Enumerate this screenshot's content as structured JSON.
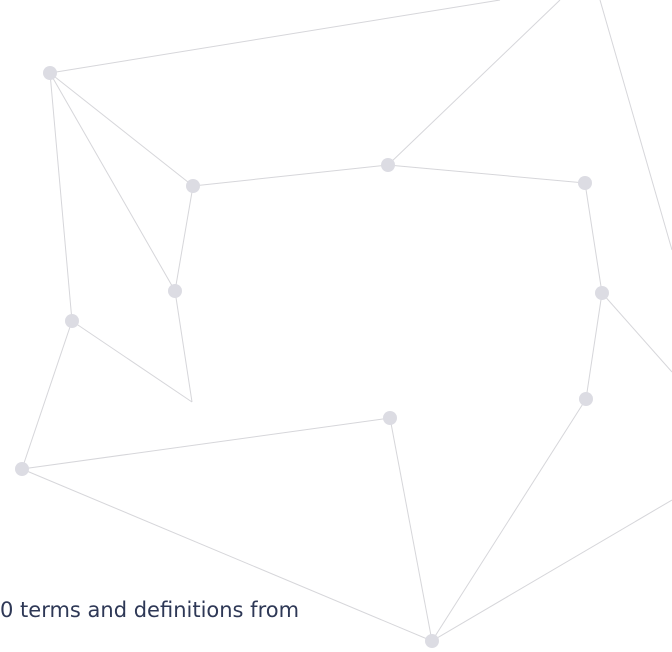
{
  "caption": "0 terms and definitions from",
  "colors": {
    "background": "#ffffff",
    "node": "#dcdce3",
    "edge": "#d6d6da",
    "text": "#2e3856"
  }
}
